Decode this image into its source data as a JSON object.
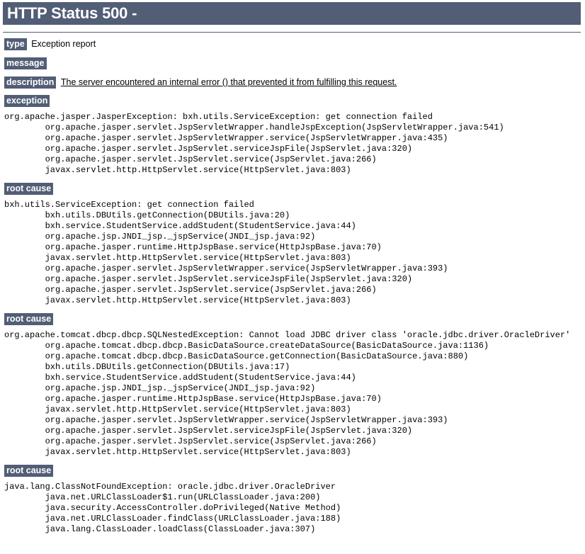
{
  "header": {
    "title": "HTTP Status 500 -"
  },
  "colors": {
    "banner_background": "#525D76",
    "banner_text": "#FFFFFF",
    "page_background": "#FFFFFF",
    "body_text": "#000000"
  },
  "fields": [
    {
      "label": "type",
      "value": "Exception report",
      "underline": false
    },
    {
      "label": "message",
      "value": "",
      "underline": false
    },
    {
      "label": "description",
      "value": "The server encountered an internal error () that prevented it from fulfilling this request.",
      "underline": true
    }
  ],
  "sections": [
    {
      "heading": "exception",
      "trace": "org.apache.jasper.JasperException: bxh.utils.ServiceException: get connection failed\n\torg.apache.jasper.servlet.JspServletWrapper.handleJspException(JspServletWrapper.java:541)\n\torg.apache.jasper.servlet.JspServletWrapper.service(JspServletWrapper.java:435)\n\torg.apache.jasper.servlet.JspServlet.serviceJspFile(JspServlet.java:320)\n\torg.apache.jasper.servlet.JspServlet.service(JspServlet.java:266)\n\tjavax.servlet.http.HttpServlet.service(HttpServlet.java:803)"
    },
    {
      "heading": "root cause",
      "trace": "bxh.utils.ServiceException: get connection failed\n\tbxh.utils.DBUtils.getConnection(DBUtils.java:20)\n\tbxh.service.StudentService.addStudent(StudentService.java:44)\n\torg.apache.jsp.JNDI_jsp._jspService(JNDI_jsp.java:92)\n\torg.apache.jasper.runtime.HttpJspBase.service(HttpJspBase.java:70)\n\tjavax.servlet.http.HttpServlet.service(HttpServlet.java:803)\n\torg.apache.jasper.servlet.JspServletWrapper.service(JspServletWrapper.java:393)\n\torg.apache.jasper.servlet.JspServlet.serviceJspFile(JspServlet.java:320)\n\torg.apache.jasper.servlet.JspServlet.service(JspServlet.java:266)\n\tjavax.servlet.http.HttpServlet.service(HttpServlet.java:803)"
    },
    {
      "heading": "root cause",
      "trace": "org.apache.tomcat.dbcp.dbcp.SQLNestedException: Cannot load JDBC driver class 'oracle.jdbc.driver.OracleDriver'\n\torg.apache.tomcat.dbcp.dbcp.BasicDataSource.createDataSource(BasicDataSource.java:1136)\n\torg.apache.tomcat.dbcp.dbcp.BasicDataSource.getConnection(BasicDataSource.java:880)\n\tbxh.utils.DBUtils.getConnection(DBUtils.java:17)\n\tbxh.service.StudentService.addStudent(StudentService.java:44)\n\torg.apache.jsp.JNDI_jsp._jspService(JNDI_jsp.java:92)\n\torg.apache.jasper.runtime.HttpJspBase.service(HttpJspBase.java:70)\n\tjavax.servlet.http.HttpServlet.service(HttpServlet.java:803)\n\torg.apache.jasper.servlet.JspServletWrapper.service(JspServletWrapper.java:393)\n\torg.apache.jasper.servlet.JspServlet.serviceJspFile(JspServlet.java:320)\n\torg.apache.jasper.servlet.JspServlet.service(JspServlet.java:266)\n\tjavax.servlet.http.HttpServlet.service(HttpServlet.java:803)"
    },
    {
      "heading": "root cause",
      "trace": "java.lang.ClassNotFoundException: oracle.jdbc.driver.OracleDriver\n\tjava.net.URLClassLoader$1.run(URLClassLoader.java:200)\n\tjava.security.AccessController.doPrivileged(Native Method)\n\tjava.net.URLClassLoader.findClass(URLClassLoader.java:188)\n\tjava.lang.ClassLoader.loadClass(ClassLoader.java:307)"
    }
  ]
}
